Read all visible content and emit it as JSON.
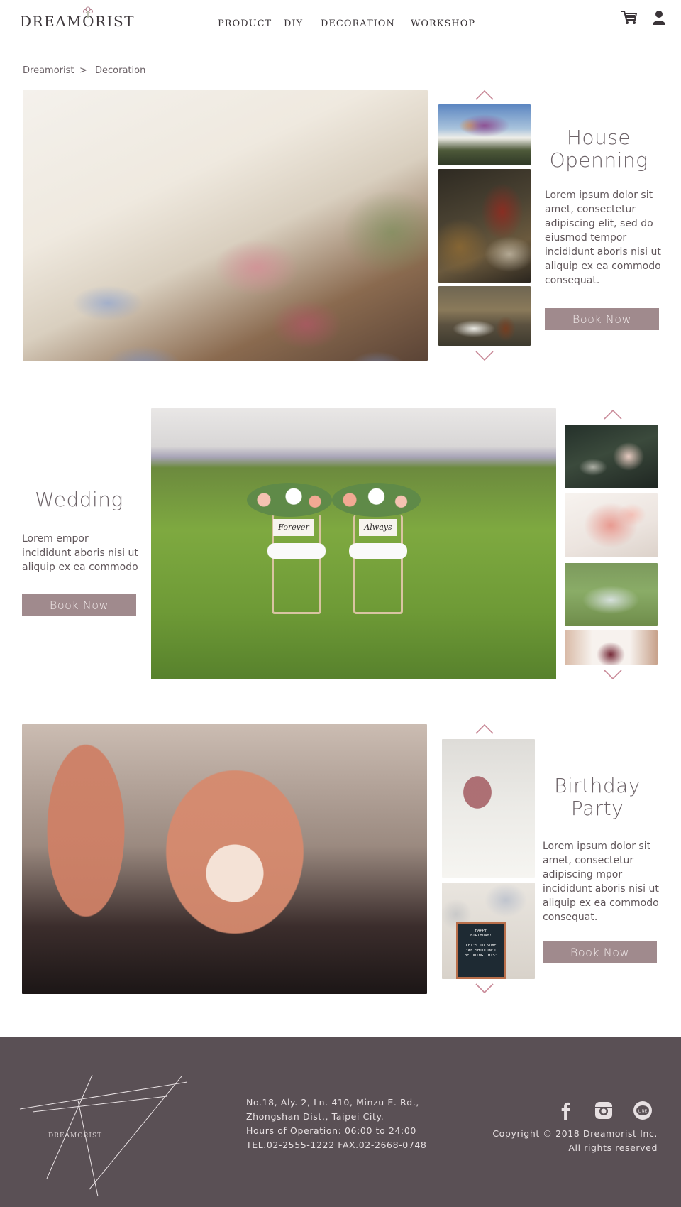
{
  "header": {
    "logo_text": "DREAMORIST",
    "nav": [
      "PRODUCT",
      "DIY",
      "DECORATION",
      "WORKSHOP"
    ],
    "icons": [
      "cart-icon",
      "user-icon"
    ]
  },
  "breadcrumb": {
    "home": "Dreamorist",
    "separator": ">",
    "current": "Decoration"
  },
  "sections": {
    "house": {
      "title": "House\nOpenning",
      "description": "Lorem ipsum dolor sit amet, consectetur adipiscing elit, sed do eiusmod tempor incididunt aboris nisi ut aliquip ex ea commodo consequat.",
      "button": "Book Now"
    },
    "wedding": {
      "title": "Wedding",
      "description": "Lorem  empor incididunt aboris nisi ut aliquip ex ea commodo",
      "button": "Book Now",
      "chair_signs": [
        "Forever",
        "Always"
      ]
    },
    "birthday": {
      "title": "Birthday\nParty",
      "description": "Lorem ipsum dolor sit amet, consectetur adipiscing mpor incididunt aboris nisi ut aliquip ex ea commodo consequat.",
      "button": "Book Now",
      "letterboard": "HAPPY\nBIRTHDAY!\n\nLET'S DO SOME\n\"WE SHOULDN'T\nBE DOING THIS\""
    }
  },
  "footer": {
    "logo_text": "DREAMORIST",
    "address": "No.18, Aly. 2, Ln. 410, Minzu E. Rd.,\nZhongshan Dist., Taipei City.\nHours of Operation: 06:00 to 24:00\nTEL.02-2555-1222 FAX.02-2668-0748",
    "copyright_line1": "Copyright © 2018 Dreamorist Inc.",
    "copyright_line2": "All rights reserved",
    "social": [
      "facebook-icon",
      "instagram-icon",
      "line-icon"
    ],
    "line_badge": "LINE"
  },
  "colors": {
    "accent": "#a08a8d",
    "arrow": "#c98a98",
    "footer_bg": "#5a5055",
    "text": "#5f5559"
  }
}
